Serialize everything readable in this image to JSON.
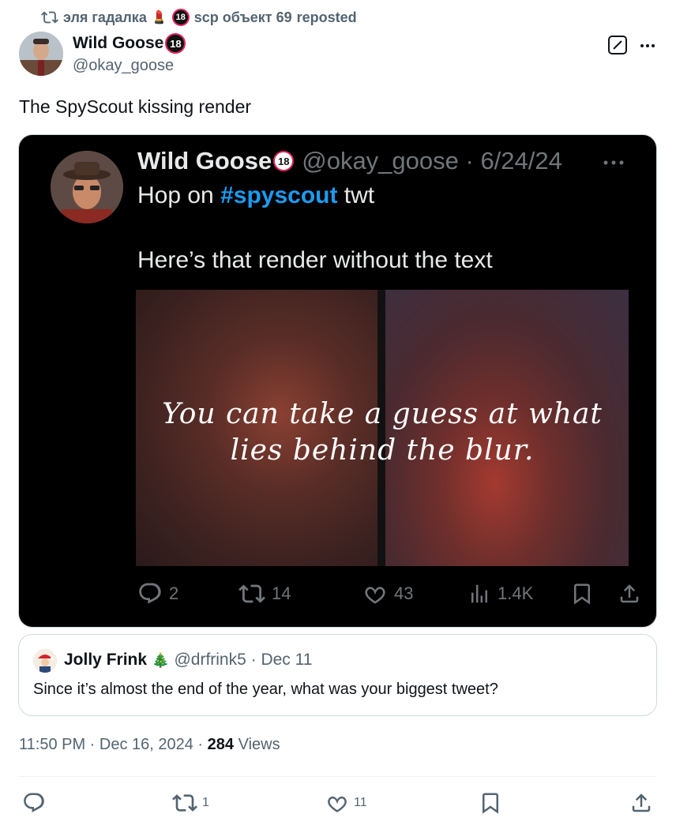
{
  "repost": {
    "reposter_name": "эля гадалка",
    "reposter_emoji": "💄",
    "reposter_badge": "18",
    "reposter_suffix": "scp объект 69",
    "label": "reposted"
  },
  "tweet": {
    "author_name": "Wild Goose",
    "author_badge": "18",
    "author_handle": "@okay_goose",
    "text": "The SpyScout kissing render",
    "timestamp": "11:50 PM · Dec 16, 2024 · ",
    "views_count": "284",
    "views_label": " Views",
    "replies": "",
    "reposts": "1",
    "likes": "11"
  },
  "quoted": {
    "author_name": "Wild Goose",
    "author_badge": "18",
    "handle_date": "@okay_goose · 6/24/24",
    "line1_pre": "Hop on ",
    "line1_hashtag": "#spyscout",
    "line1_post": " twt",
    "line2": "Here’s that render without the text",
    "overlay_line1": "You can take a guess at what",
    "overlay_line2": "lies behind the blur.",
    "replies": "2",
    "reposts": "14",
    "likes": "43",
    "views": "1.4K"
  },
  "reply": {
    "author_name": "Jolly Frink",
    "author_emoji": "🎄",
    "handle_date": "@drfrink5 · Dec 11",
    "text": "Since it’s almost the end of the year, what was your biggest tweet?"
  },
  "icons": [
    "retweet-icon",
    "edit-icon",
    "more-icon",
    "reply-icon",
    "like-icon",
    "views-icon",
    "bookmark-icon",
    "share-icon"
  ],
  "colors": {
    "accent": "#1d9bf0",
    "text": "#0f1419",
    "muted": "#536471",
    "dark_bg": "#000000"
  }
}
